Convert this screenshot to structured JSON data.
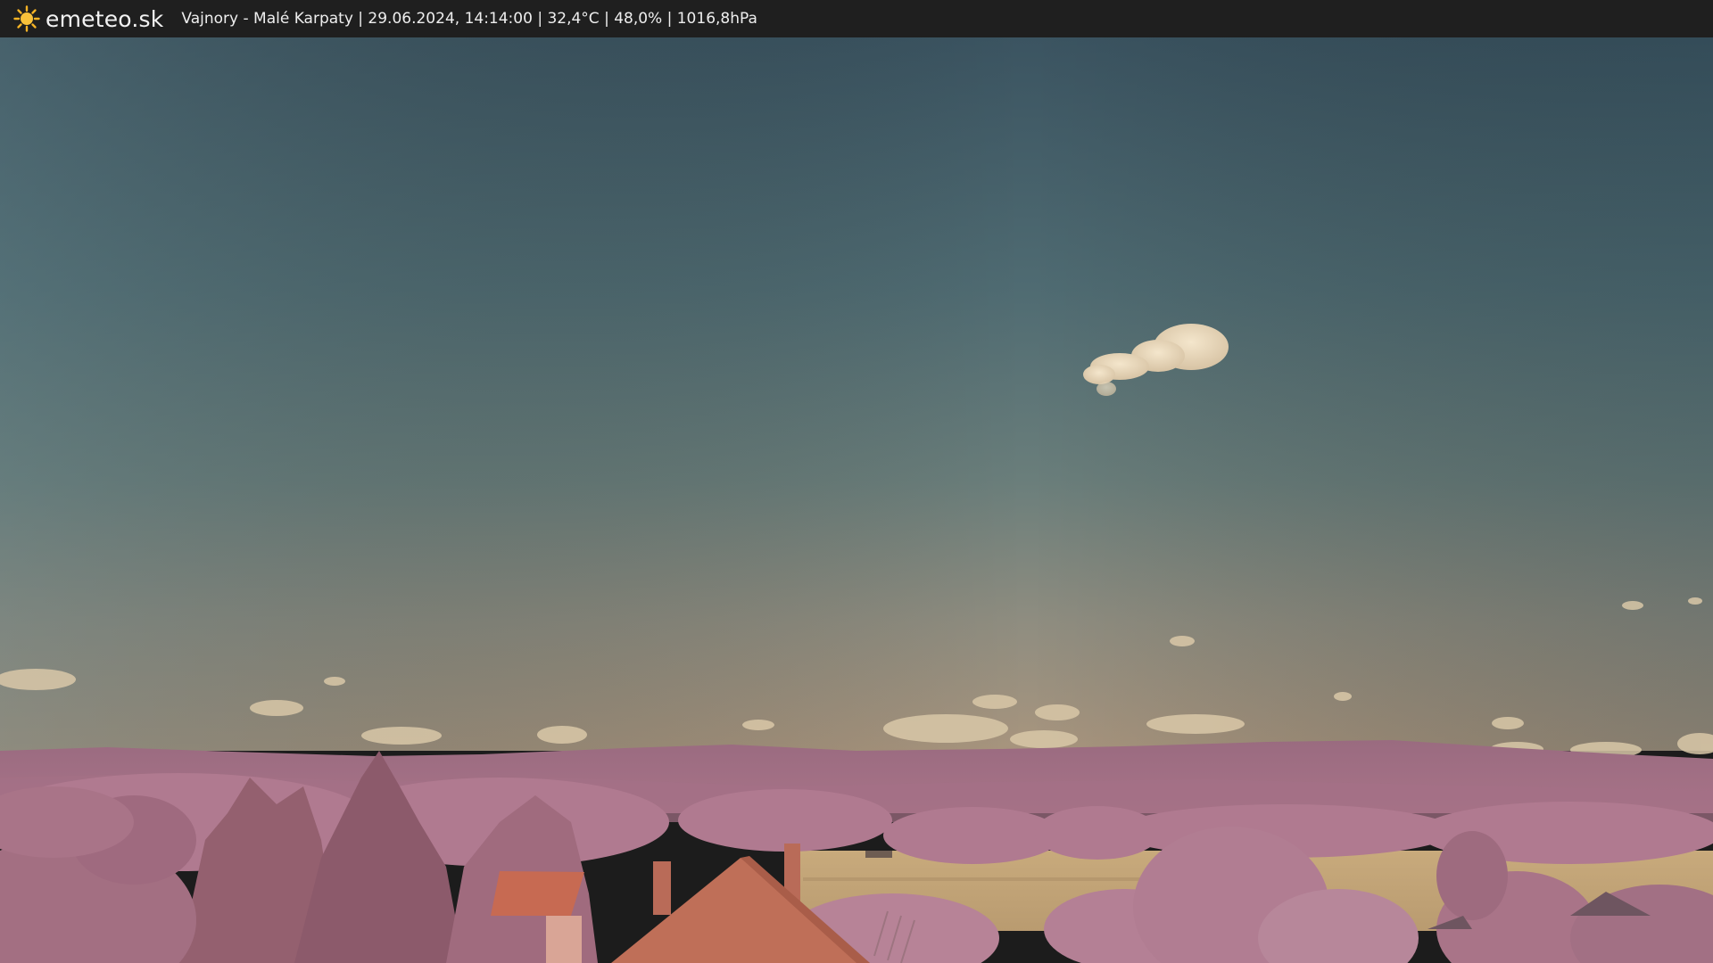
{
  "overlay": {
    "logo_icon": "sun-icon",
    "brand": "emeteo.sk",
    "caption": "Vajnory - Malé Karpaty | 29.06.2024, 14:14:00 | 32,4°C | 48,0% | 1016,8hPa"
  },
  "colors": {
    "bar_background": "#1f1f1f",
    "sky_top": "#3d5763",
    "sky_horizon": "#a3977f",
    "hills": "#9b6a7f",
    "foliage": "#b27a90",
    "field": "#c2a579",
    "roof": "#c46a50",
    "sun": "#f5b325"
  }
}
